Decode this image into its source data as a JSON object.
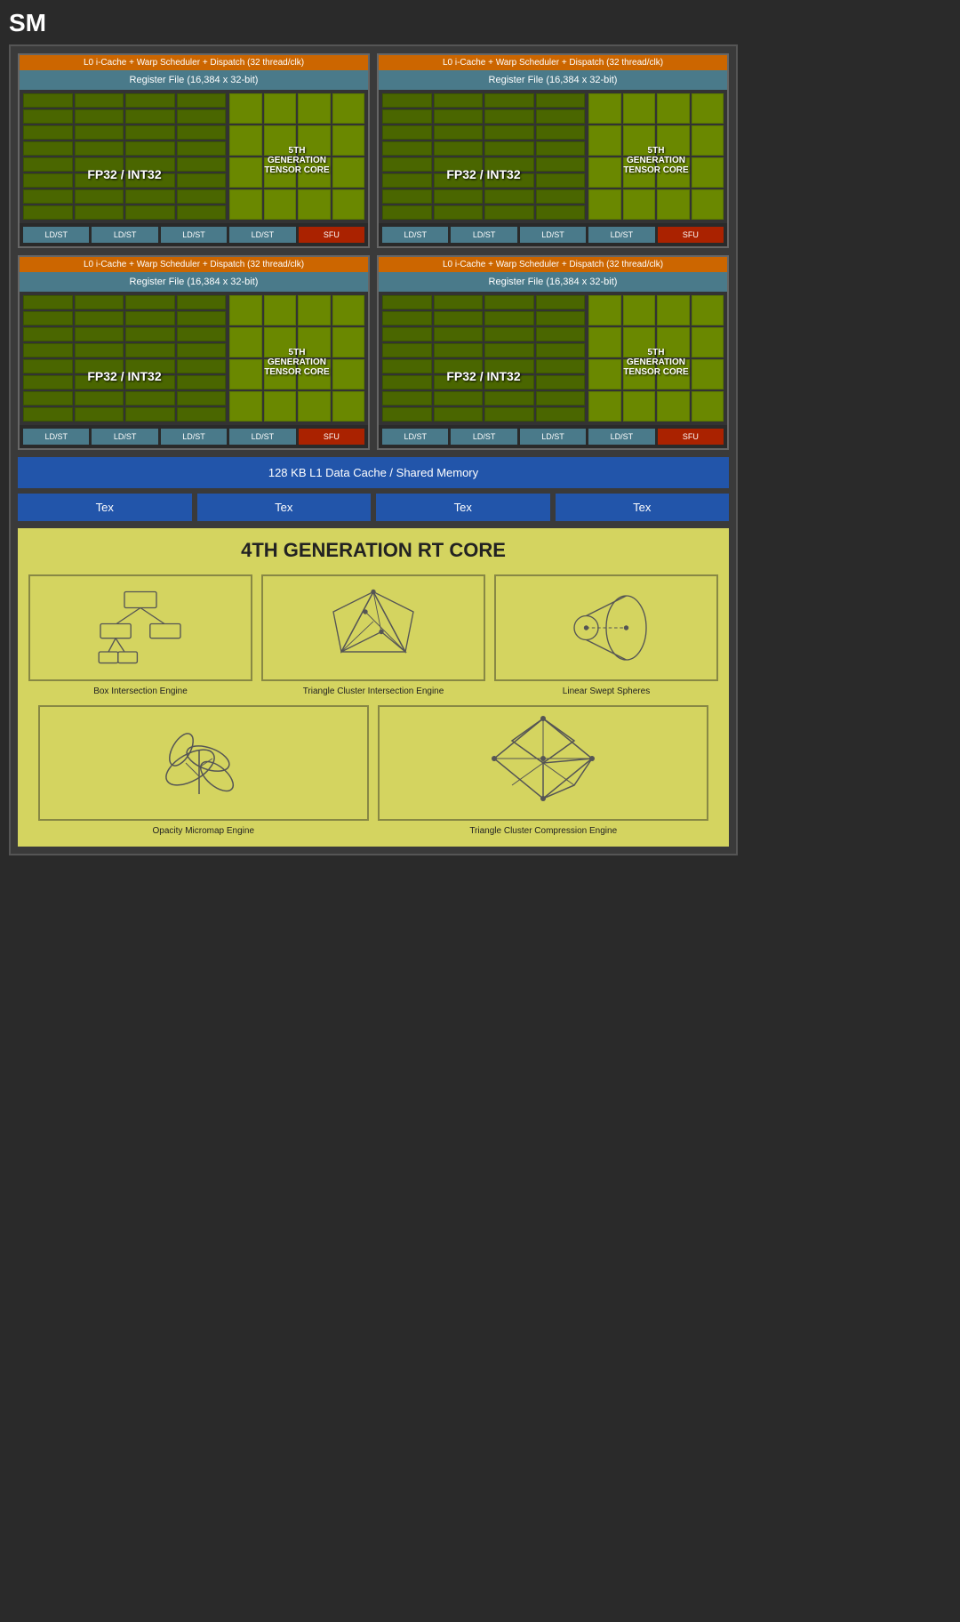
{
  "title": "SM",
  "warp_scheduler": "L0 i-Cache + Warp Scheduler + Dispatch (32 thread/clk)",
  "register_file": "Register File (16,384 x 32-bit)",
  "fp32_label": "FP32 / INT32",
  "tensor_label": "5TH\nGENERATION\nTENSOR CORE",
  "ldst_buttons": [
    "LD/ST",
    "LD/ST",
    "LD/ST",
    "LD/ST"
  ],
  "sfu_label": "SFU",
  "l1_cache": "128 KB L1 Data Cache / Shared Memory",
  "tex_labels": [
    "Tex",
    "Tex",
    "Tex",
    "Tex"
  ],
  "rt_core_title": "4TH GENERATION RT CORE",
  "rt_engines_row1": [
    {
      "label": "Box Intersection Engine"
    },
    {
      "label": "Triangle Cluster Intersection Engine"
    },
    {
      "label": "Linear Swept Spheres"
    }
  ],
  "rt_engines_row2": [
    {
      "label": "Opacity Micromap Engine"
    },
    {
      "label": "Triangle Cluster Compression Engine"
    }
  ]
}
